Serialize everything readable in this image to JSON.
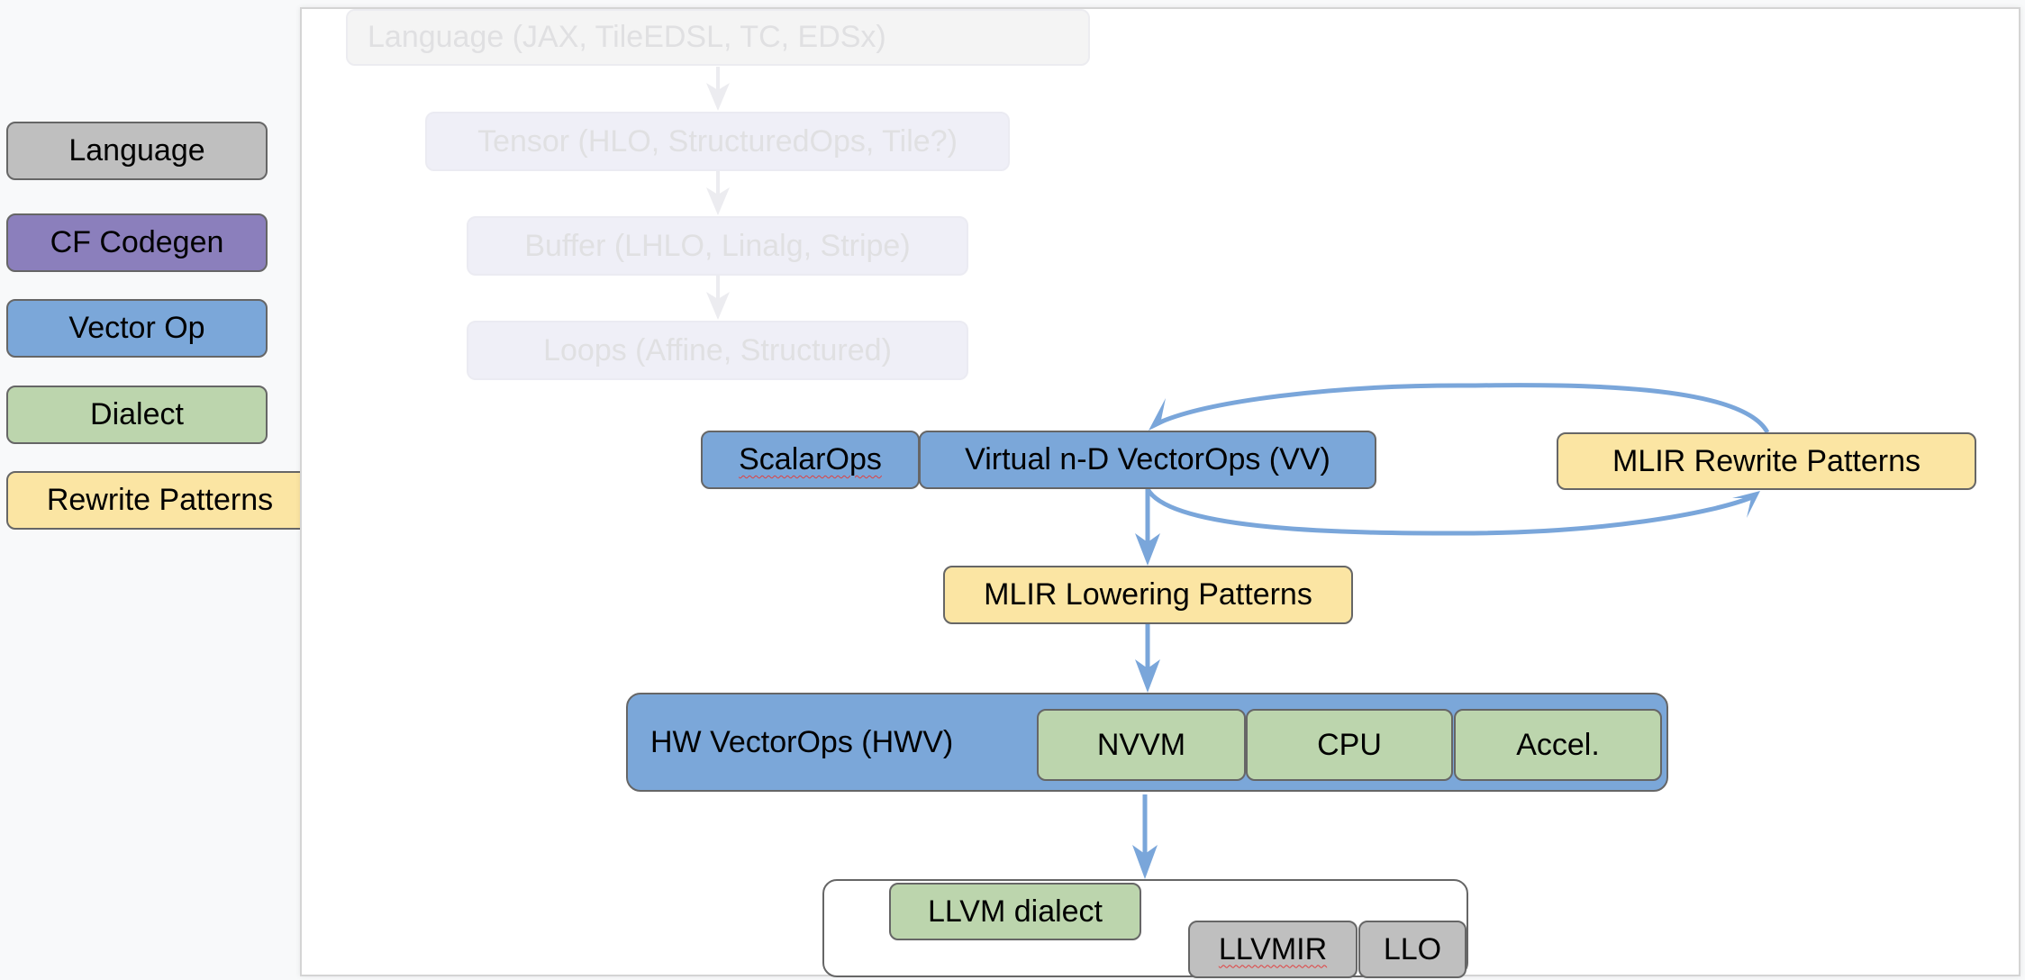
{
  "legend": {
    "items": [
      {
        "label": "Language",
        "color": "#bfbfbf"
      },
      {
        "label": "CF Codegen",
        "color": "#8b7fbc"
      },
      {
        "label": "Vector Op",
        "color": "#7ba7d9"
      },
      {
        "label": "Dialect",
        "color": "#bcd5ad"
      },
      {
        "label": "Rewrite Patterns",
        "color": "#fbe5a3"
      }
    ]
  },
  "diagram": {
    "faded_stack": [
      {
        "label": "Language (JAX, TileEDSL, TC, EDSx)"
      },
      {
        "label": "Tensor (HLO, StructuredOps, Tile?)"
      },
      {
        "label": "Buffer (LHLO, Linalg, Stripe)"
      },
      {
        "label": "Loops (Affine, Structured)"
      }
    ],
    "scalar_ops": "ScalarOps",
    "virtual_vector_ops": "Virtual n-D VectorOps (VV)",
    "rewrite_patterns": "MLIR Rewrite Patterns",
    "lowering_patterns": "MLIR Lowering Patterns",
    "hw_vector_ops": {
      "label": "HW VectorOps (HWV)",
      "targets": [
        "NVVM",
        "CPU",
        "Accel."
      ]
    },
    "llvm_group": {
      "dialect": "LLVM dialect",
      "backends": [
        "LLVMIR",
        "LLO"
      ]
    },
    "arrow_color": "#7aa6da"
  }
}
